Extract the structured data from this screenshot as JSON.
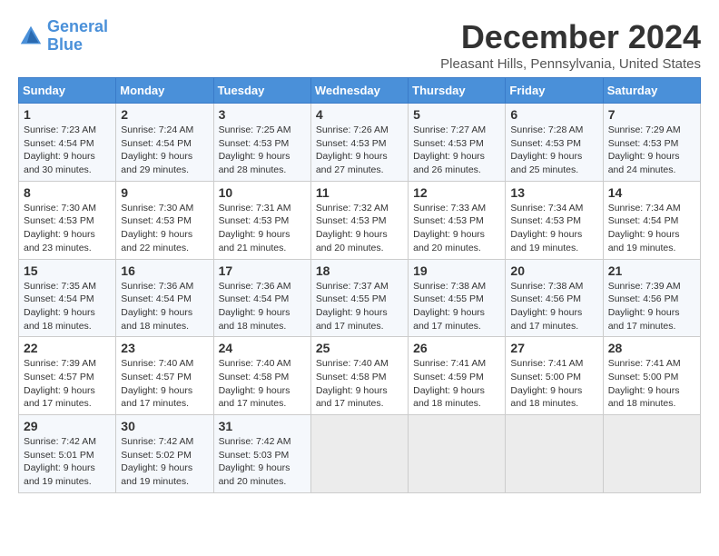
{
  "logo": {
    "line1": "General",
    "line2": "Blue"
  },
  "title": "December 2024",
  "location": "Pleasant Hills, Pennsylvania, United States",
  "days_of_week": [
    "Sunday",
    "Monday",
    "Tuesday",
    "Wednesday",
    "Thursday",
    "Friday",
    "Saturday"
  ],
  "weeks": [
    [
      {
        "day": "1",
        "info": "Sunrise: 7:23 AM\nSunset: 4:54 PM\nDaylight: 9 hours\nand 30 minutes."
      },
      {
        "day": "2",
        "info": "Sunrise: 7:24 AM\nSunset: 4:54 PM\nDaylight: 9 hours\nand 29 minutes."
      },
      {
        "day": "3",
        "info": "Sunrise: 7:25 AM\nSunset: 4:53 PM\nDaylight: 9 hours\nand 28 minutes."
      },
      {
        "day": "4",
        "info": "Sunrise: 7:26 AM\nSunset: 4:53 PM\nDaylight: 9 hours\nand 27 minutes."
      },
      {
        "day": "5",
        "info": "Sunrise: 7:27 AM\nSunset: 4:53 PM\nDaylight: 9 hours\nand 26 minutes."
      },
      {
        "day": "6",
        "info": "Sunrise: 7:28 AM\nSunset: 4:53 PM\nDaylight: 9 hours\nand 25 minutes."
      },
      {
        "day": "7",
        "info": "Sunrise: 7:29 AM\nSunset: 4:53 PM\nDaylight: 9 hours\nand 24 minutes."
      }
    ],
    [
      {
        "day": "8",
        "info": "Sunrise: 7:30 AM\nSunset: 4:53 PM\nDaylight: 9 hours\nand 23 minutes."
      },
      {
        "day": "9",
        "info": "Sunrise: 7:30 AM\nSunset: 4:53 PM\nDaylight: 9 hours\nand 22 minutes."
      },
      {
        "day": "10",
        "info": "Sunrise: 7:31 AM\nSunset: 4:53 PM\nDaylight: 9 hours\nand 21 minutes."
      },
      {
        "day": "11",
        "info": "Sunrise: 7:32 AM\nSunset: 4:53 PM\nDaylight: 9 hours\nand 20 minutes."
      },
      {
        "day": "12",
        "info": "Sunrise: 7:33 AM\nSunset: 4:53 PM\nDaylight: 9 hours\nand 20 minutes."
      },
      {
        "day": "13",
        "info": "Sunrise: 7:34 AM\nSunset: 4:53 PM\nDaylight: 9 hours\nand 19 minutes."
      },
      {
        "day": "14",
        "info": "Sunrise: 7:34 AM\nSunset: 4:54 PM\nDaylight: 9 hours\nand 19 minutes."
      }
    ],
    [
      {
        "day": "15",
        "info": "Sunrise: 7:35 AM\nSunset: 4:54 PM\nDaylight: 9 hours\nand 18 minutes."
      },
      {
        "day": "16",
        "info": "Sunrise: 7:36 AM\nSunset: 4:54 PM\nDaylight: 9 hours\nand 18 minutes."
      },
      {
        "day": "17",
        "info": "Sunrise: 7:36 AM\nSunset: 4:54 PM\nDaylight: 9 hours\nand 18 minutes."
      },
      {
        "day": "18",
        "info": "Sunrise: 7:37 AM\nSunset: 4:55 PM\nDaylight: 9 hours\nand 17 minutes."
      },
      {
        "day": "19",
        "info": "Sunrise: 7:38 AM\nSunset: 4:55 PM\nDaylight: 9 hours\nand 17 minutes."
      },
      {
        "day": "20",
        "info": "Sunrise: 7:38 AM\nSunset: 4:56 PM\nDaylight: 9 hours\nand 17 minutes."
      },
      {
        "day": "21",
        "info": "Sunrise: 7:39 AM\nSunset: 4:56 PM\nDaylight: 9 hours\nand 17 minutes."
      }
    ],
    [
      {
        "day": "22",
        "info": "Sunrise: 7:39 AM\nSunset: 4:57 PM\nDaylight: 9 hours\nand 17 minutes."
      },
      {
        "day": "23",
        "info": "Sunrise: 7:40 AM\nSunset: 4:57 PM\nDaylight: 9 hours\nand 17 minutes."
      },
      {
        "day": "24",
        "info": "Sunrise: 7:40 AM\nSunset: 4:58 PM\nDaylight: 9 hours\nand 17 minutes."
      },
      {
        "day": "25",
        "info": "Sunrise: 7:40 AM\nSunset: 4:58 PM\nDaylight: 9 hours\nand 17 minutes."
      },
      {
        "day": "26",
        "info": "Sunrise: 7:41 AM\nSunset: 4:59 PM\nDaylight: 9 hours\nand 18 minutes."
      },
      {
        "day": "27",
        "info": "Sunrise: 7:41 AM\nSunset: 5:00 PM\nDaylight: 9 hours\nand 18 minutes."
      },
      {
        "day": "28",
        "info": "Sunrise: 7:41 AM\nSunset: 5:00 PM\nDaylight: 9 hours\nand 18 minutes."
      }
    ],
    [
      {
        "day": "29",
        "info": "Sunrise: 7:42 AM\nSunset: 5:01 PM\nDaylight: 9 hours\nand 19 minutes."
      },
      {
        "day": "30",
        "info": "Sunrise: 7:42 AM\nSunset: 5:02 PM\nDaylight: 9 hours\nand 19 minutes."
      },
      {
        "day": "31",
        "info": "Sunrise: 7:42 AM\nSunset: 5:03 PM\nDaylight: 9 hours\nand 20 minutes."
      },
      {
        "day": "",
        "info": ""
      },
      {
        "day": "",
        "info": ""
      },
      {
        "day": "",
        "info": ""
      },
      {
        "day": "",
        "info": ""
      }
    ]
  ]
}
